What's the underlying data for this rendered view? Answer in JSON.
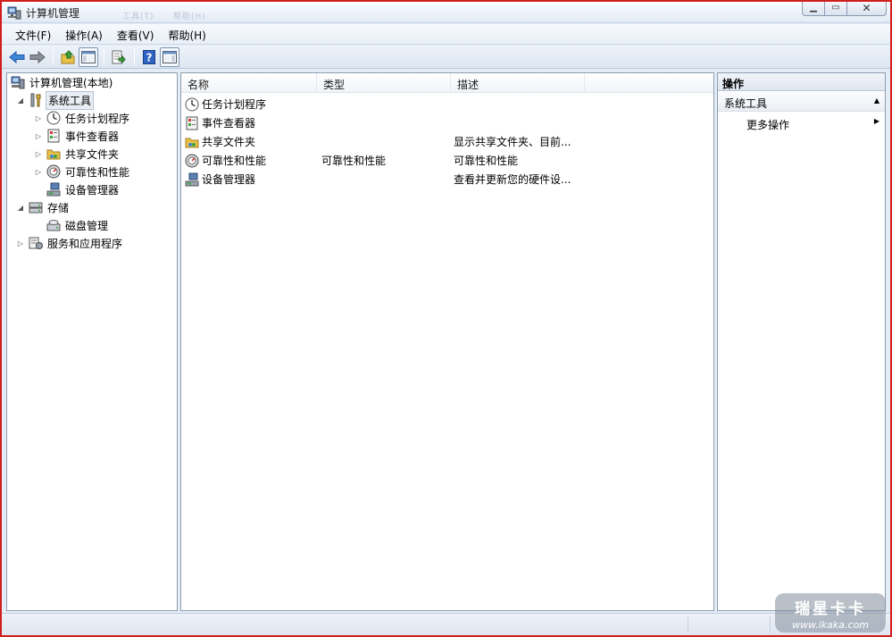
{
  "window": {
    "title": "计算机管理",
    "ghost_tabs": [
      "工具(T)",
      "帮助(H)"
    ]
  },
  "menubar": {
    "items": [
      {
        "label": "文件(F)"
      },
      {
        "label": "操作(A)"
      },
      {
        "label": "查看(V)"
      },
      {
        "label": "帮助(H)"
      }
    ]
  },
  "tree": {
    "items": [
      {
        "label": "计算机管理(本地)",
        "icon": "computer-management-icon",
        "level": 0,
        "expander": ""
      },
      {
        "label": "系统工具",
        "icon": "system-tools-icon",
        "level": 1,
        "expander": "◢",
        "selected": true
      },
      {
        "label": "任务计划程序",
        "icon": "task-scheduler-icon",
        "level": 2,
        "expander": "▷"
      },
      {
        "label": "事件查看器",
        "icon": "event-viewer-icon",
        "level": 2,
        "expander": "▷"
      },
      {
        "label": "共享文件夹",
        "icon": "shared-folder-icon",
        "level": 2,
        "expander": "▷"
      },
      {
        "label": "可靠性和性能",
        "icon": "reliability-icon",
        "level": 2,
        "expander": "▷"
      },
      {
        "label": "设备管理器",
        "icon": "device-manager-icon",
        "level": 2,
        "expander": ""
      },
      {
        "label": "存储",
        "icon": "storage-icon",
        "level": 1,
        "expander": "◢"
      },
      {
        "label": "磁盘管理",
        "icon": "disk-management-icon",
        "level": 2,
        "expander": ""
      },
      {
        "label": "服务和应用程序",
        "icon": "services-apps-icon",
        "level": 1,
        "expander": "▷"
      }
    ]
  },
  "list": {
    "columns": [
      "名称",
      "类型",
      "描述"
    ],
    "rows": [
      {
        "name": "任务计划程序",
        "type": "",
        "desc": "",
        "icon": "task-scheduler-icon"
      },
      {
        "name": "事件查看器",
        "type": "",
        "desc": "",
        "icon": "event-viewer-icon"
      },
      {
        "name": "共享文件夹",
        "type": "",
        "desc": "显示共享文件夹、目前...",
        "icon": "shared-folder-icon"
      },
      {
        "name": "可靠性和性能",
        "type": "可靠性和性能",
        "desc": "可靠性和性能",
        "icon": "reliability-icon"
      },
      {
        "name": "设备管理器",
        "type": "",
        "desc": "查看并更新您的硬件设...",
        "icon": "device-manager-icon"
      }
    ]
  },
  "actions": {
    "header": "操作",
    "section": "系统工具",
    "item": "更多操作"
  },
  "watermark": {
    "brand": "瑞星卡卡",
    "url": "www.ikaka.com"
  },
  "colors": {
    "frame": "#d21d1d",
    "chrome": "#e4ecf6",
    "selection": "#e9eef4"
  }
}
